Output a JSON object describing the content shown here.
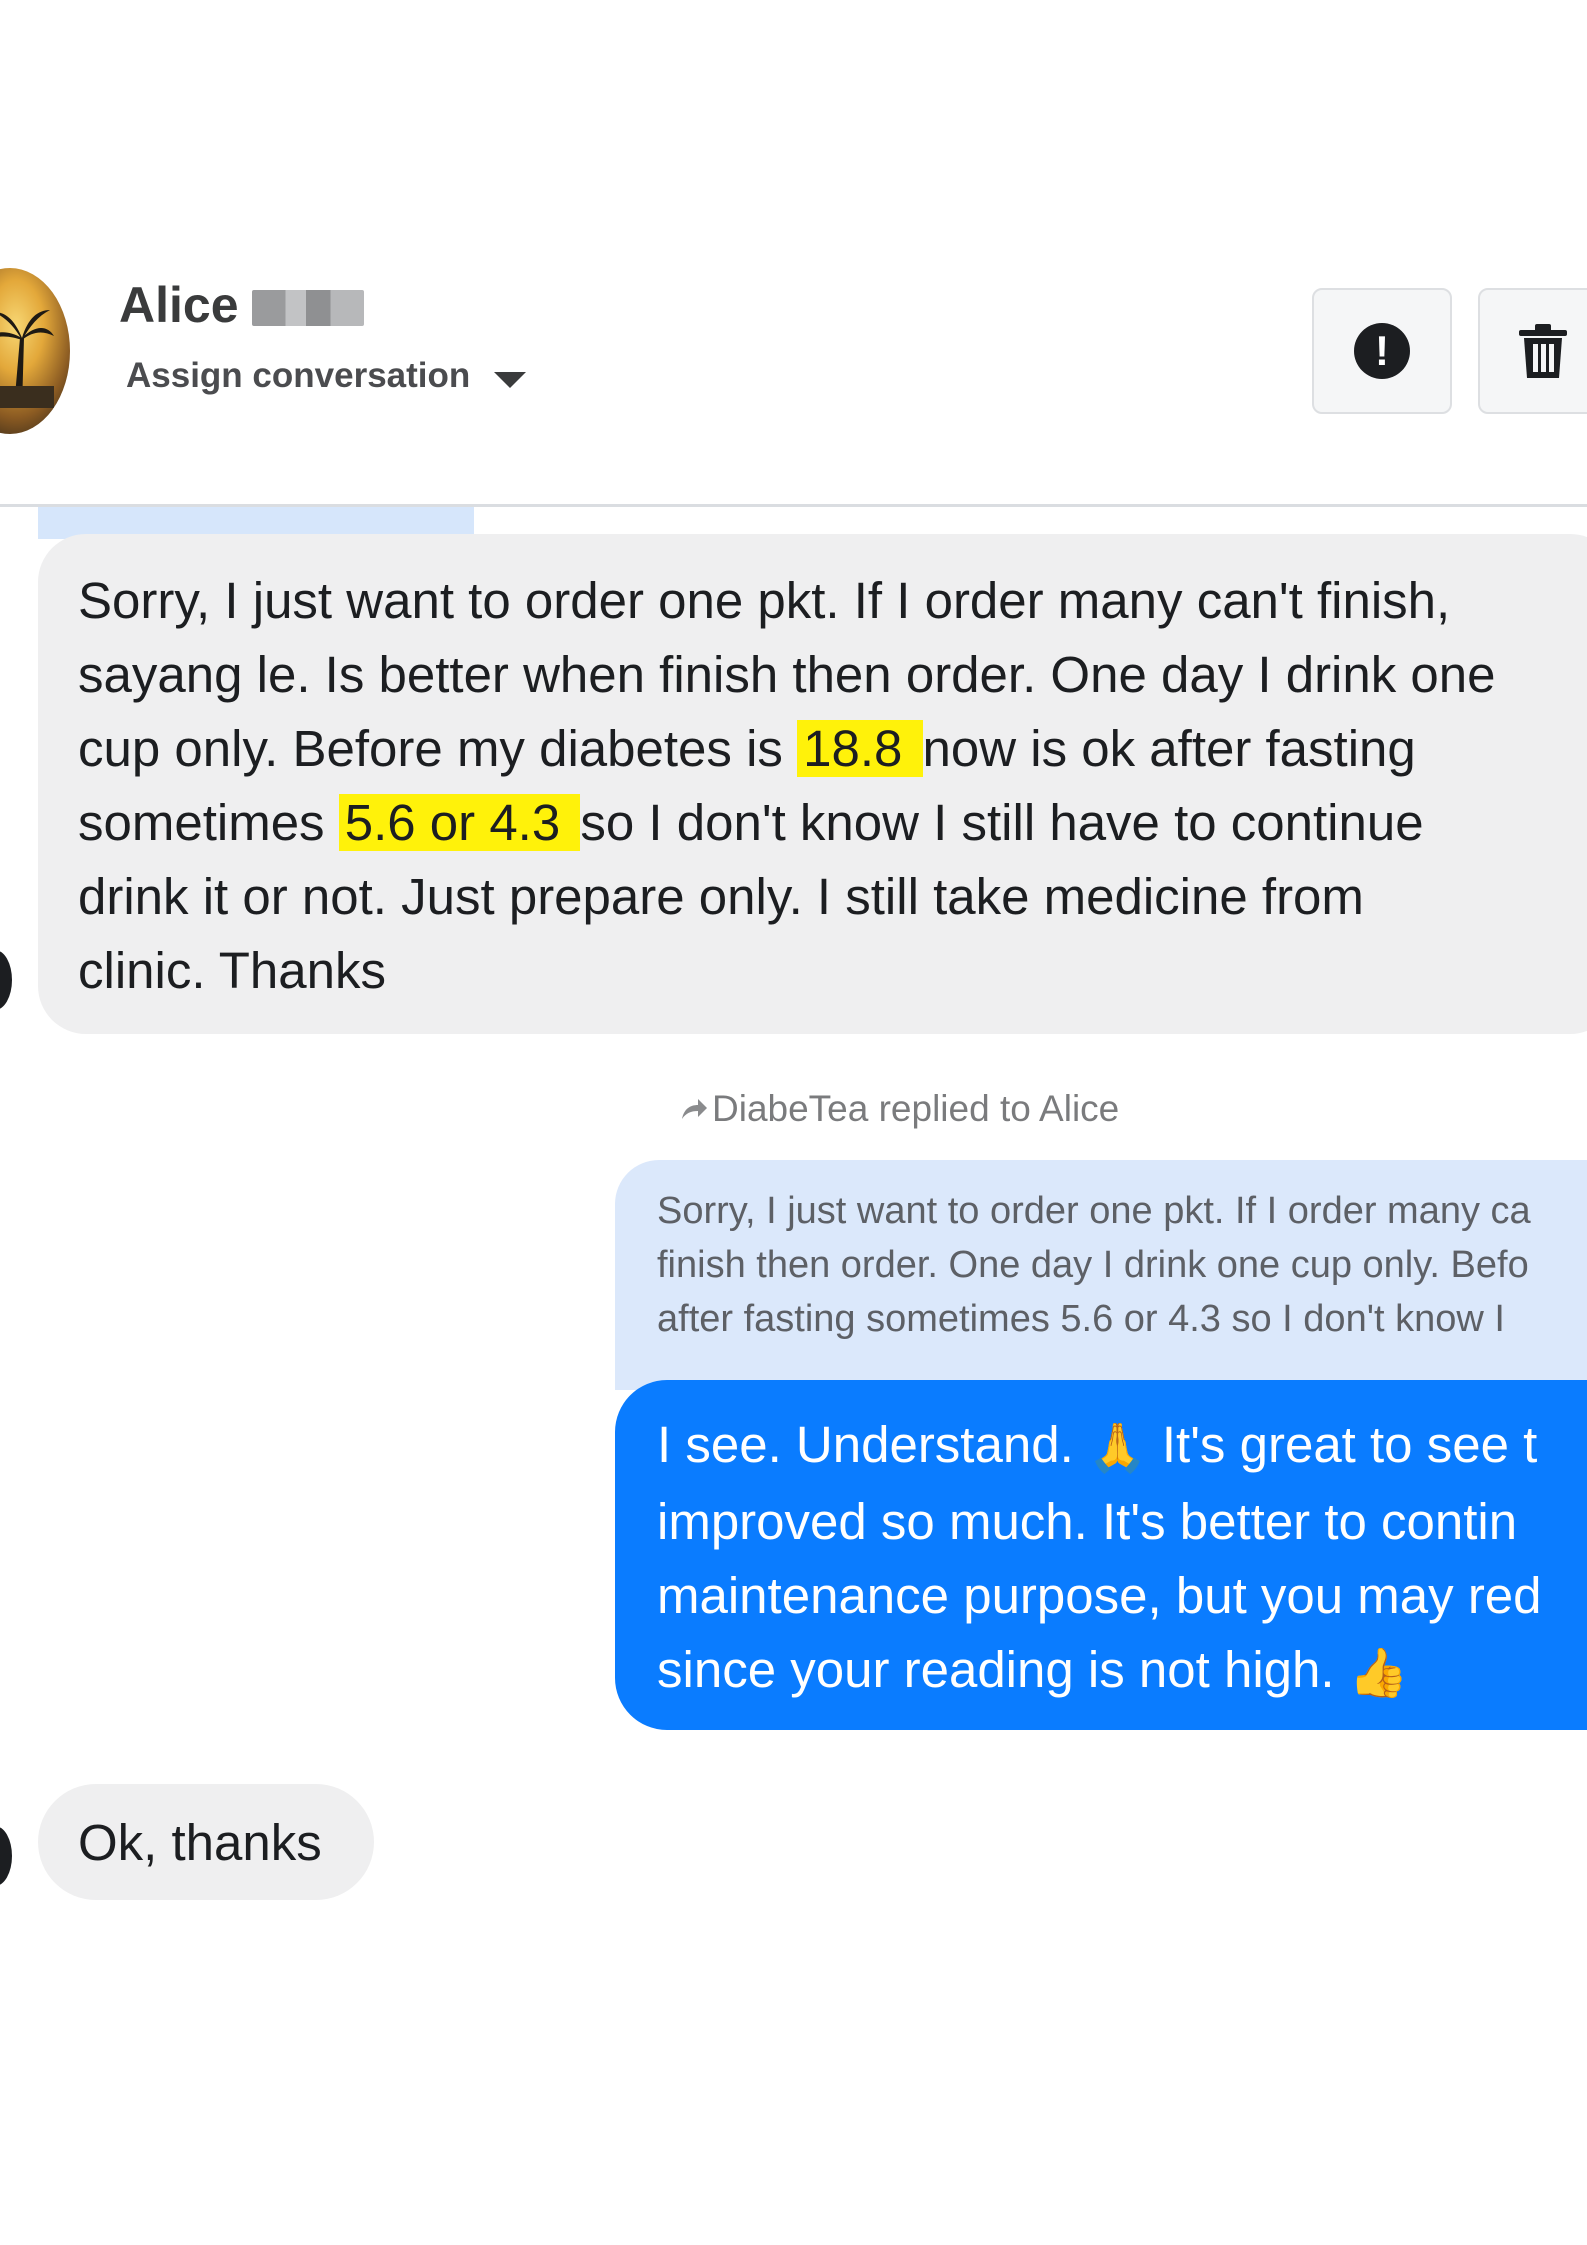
{
  "header": {
    "contact_name": "Alice",
    "assign_label": "Assign conversation",
    "report_icon": "alert-circle-icon",
    "delete_icon": "trash-icon"
  },
  "messages": {
    "incoming_1": {
      "lines": [
        "Sorry, I just want to order one pkt. If I order many can't finish,",
        "sayang le. Is better when finish then order. One day I drink one",
        "cup only. Before my diabetes is ",
        "18.8 ",
        "now is ok after fasting",
        "sometimes ",
        "5.6 or 4.3 ",
        "so I don't know I still have to continue",
        "drink it or not. Just prepare only. I still take medicine from",
        "clinic. Thanks"
      ]
    },
    "reply_meta": "DiabeTea replied to Alice",
    "quoted": {
      "lines": [
        "Sorry, I just want to order one pkt. If I order many ca",
        "finish then order. One day I drink one cup only. Befo",
        "after fasting sometimes 5.6 or 4.3 so I don't know I"
      ]
    },
    "outgoing_1": {
      "line1_a": "I see. Understand. ",
      "line1_b": " It's great to see t",
      "line2": "improved so much. It's better to contin",
      "line3": "maintenance purpose, but you may red",
      "line4": "since your reading is not high. "
    },
    "incoming_2": {
      "text": "Ok, thanks"
    }
  },
  "colors": {
    "outgoing_bubble": "#0a7cff",
    "incoming_bubble": "#efeff0",
    "quoted_bubble": "#dbe8fb",
    "highlight": "#fff20a"
  }
}
